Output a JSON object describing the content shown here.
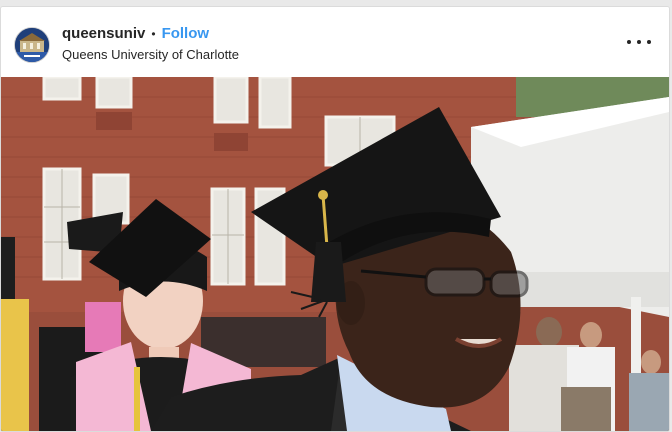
{
  "post": {
    "username": "queensuniv",
    "separator": "•",
    "follow_label": "Follow",
    "location": "Queens University of Charlotte",
    "more_icon": "more-options-icon"
  },
  "avatar": {
    "icon": "university-logo-avatar"
  },
  "photo": {
    "subject": "graduation-photo"
  }
}
